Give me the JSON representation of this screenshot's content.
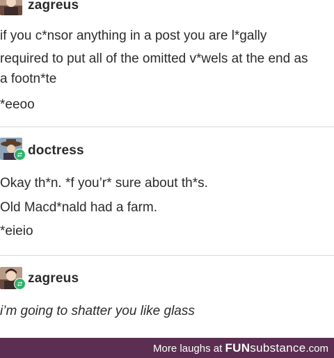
{
  "posts": [
    {
      "username": "zagreus",
      "lines": [
        "if you c*nsor anything in a post you are l*gally",
        "required to put all of the omitted v*wels at the end as",
        "a footn*te",
        "*eeoo"
      ]
    },
    {
      "username": "doctress",
      "lines": [
        "Okay th*n. *f you’r* sure about th*s.",
        "Old Macd*nald had a farm.",
        "*eieio"
      ]
    },
    {
      "username": "zagreus",
      "lines": [
        "i’m going to shatter you like glass"
      ]
    }
  ],
  "footer": {
    "prefix": "More laughs at ",
    "brand_fun": "FUN",
    "brand_substance": "substance",
    "brand_tld": ".com"
  },
  "colors": {
    "footer_bg": "#5b2e52",
    "reblog_icon": "#2fb36b"
  },
  "icons": [
    "zagreus-avatar-icon",
    "doctress-avatar-icon",
    "reblog-icon"
  ]
}
